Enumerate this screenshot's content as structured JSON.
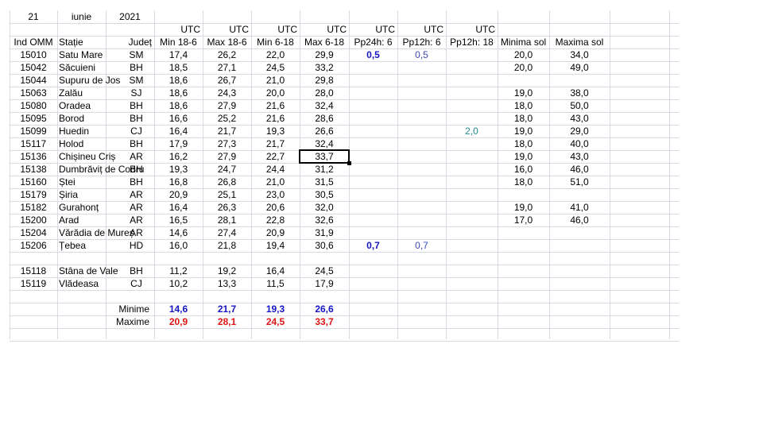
{
  "header": {
    "day": "21",
    "month": "iunie",
    "year": "2021"
  },
  "utc_label": "UTC",
  "columns": [
    "Ind OMM",
    "Stație",
    "Județ",
    "Min 18-6",
    "Max 18-6",
    "Min 6-18",
    "Max 6-18",
    "Pp24h: 6",
    "Pp12h: 6",
    "Pp12h: 18",
    "Minima sol",
    "Maxima sol"
  ],
  "rows": [
    {
      "omm": "15010",
      "station": "Satu Mare",
      "county": "SM",
      "min186": "17,4",
      "max186": "26,2",
      "min618": "22,0",
      "max618": "29,9",
      "pp24": "0,5",
      "pp12_6": "0,5",
      "pp12_18": "",
      "minsol": "20,0",
      "maxsol": "34,0"
    },
    {
      "omm": "15042",
      "station": "Săcuieni",
      "county": "BH",
      "min186": "18,5",
      "max186": "27,1",
      "min618": "24,5",
      "max618": "33,2",
      "pp24": "",
      "pp12_6": "",
      "pp12_18": "",
      "minsol": "20,0",
      "maxsol": "49,0"
    },
    {
      "omm": "15044",
      "station": "Supuru de Jos",
      "county": "SM",
      "min186": "18,6",
      "max186": "26,7",
      "min618": "21,0",
      "max618": "29,8",
      "pp24": "",
      "pp12_6": "",
      "pp12_18": "",
      "minsol": "",
      "maxsol": ""
    },
    {
      "omm": "15063",
      "station": "Zalău",
      "county": "SJ",
      "min186": "18,6",
      "max186": "24,3",
      "min618": "20,0",
      "max618": "28,0",
      "pp24": "",
      "pp12_6": "",
      "pp12_18": "",
      "minsol": "19,0",
      "maxsol": "38,0"
    },
    {
      "omm": "15080",
      "station": "Oradea",
      "county": "BH",
      "min186": "18,6",
      "max186": "27,9",
      "min618": "21,6",
      "max618": "32,4",
      "pp24": "",
      "pp12_6": "",
      "pp12_18": "",
      "minsol": "18,0",
      "maxsol": "50,0"
    },
    {
      "omm": "15095",
      "station": "Borod",
      "county": "BH",
      "min186": "16,6",
      "max186": "25,2",
      "min618": "21,6",
      "max618": "28,6",
      "pp24": "",
      "pp12_6": "",
      "pp12_18": "",
      "minsol": "18,0",
      "maxsol": "43,0"
    },
    {
      "omm": "15099",
      "station": "Huedin",
      "county": "CJ",
      "min186": "16,4",
      "max186": "21,7",
      "min618": "19,3",
      "max618": "26,6",
      "pp24": "",
      "pp12_6": "",
      "pp12_18": "2,0",
      "minsol": "19,0",
      "maxsol": "29,0"
    },
    {
      "omm": "15117",
      "station": "Holod",
      "county": "BH",
      "min186": "17,9",
      "max186": "27,3",
      "min618": "21,7",
      "max618": "32,4",
      "pp24": "",
      "pp12_6": "",
      "pp12_18": "",
      "minsol": "18,0",
      "maxsol": "40,0"
    },
    {
      "omm": "15136",
      "station": "Chișineu  Criș",
      "county": "AR",
      "min186": "16,2",
      "max186": "27,9",
      "min618": "22,7",
      "max618": "33,7",
      "pp24": "",
      "pp12_6": "",
      "pp12_18": "",
      "minsol": "19,0",
      "maxsol": "43,0"
    },
    {
      "omm": "15138",
      "station": "Dumbrăviț  de Codru",
      "county": "BH",
      "min186": "19,3",
      "max186": "24,7",
      "min618": "24,4",
      "max618": "31,2",
      "pp24": "",
      "pp12_6": "",
      "pp12_18": "",
      "minsol": "16,0",
      "maxsol": "46,0"
    },
    {
      "omm": "15160",
      "station": "Ștei",
      "county": "BH",
      "min186": "16,8",
      "max186": "26,8",
      "min618": "21,0",
      "max618": "31,5",
      "pp24": "",
      "pp12_6": "",
      "pp12_18": "",
      "minsol": "18,0",
      "maxsol": "51,0"
    },
    {
      "omm": "15179",
      "station": "Șiria",
      "county": "AR",
      "min186": "20,9",
      "max186": "25,1",
      "min618": "23,0",
      "max618": "30,5",
      "pp24": "",
      "pp12_6": "",
      "pp12_18": "",
      "minsol": "",
      "maxsol": ""
    },
    {
      "omm": "15182",
      "station": "Gurahonț",
      "county": "AR",
      "min186": "16,4",
      "max186": "26,3",
      "min618": "20,6",
      "max618": "32,0",
      "pp24": "",
      "pp12_6": "",
      "pp12_18": "",
      "minsol": "19,0",
      "maxsol": "41,0"
    },
    {
      "omm": "15200",
      "station": "Arad",
      "county": "AR",
      "min186": "16,5",
      "max186": "28,1",
      "min618": "22,8",
      "max618": "32,6",
      "pp24": "",
      "pp12_6": "",
      "pp12_18": "",
      "minsol": "17,0",
      "maxsol": "46,0"
    },
    {
      "omm": "15204",
      "station": "Vărădia de Mureș",
      "county": "AR",
      "min186": "14,6",
      "max186": "27,4",
      "min618": "20,9",
      "max618": "31,9",
      "pp24": "",
      "pp12_6": "",
      "pp12_18": "",
      "minsol": "",
      "maxsol": ""
    },
    {
      "omm": "15206",
      "station": "Țebea",
      "county": "HD",
      "min186": "16,0",
      "max186": "21,8",
      "min618": "19,4",
      "max618": "30,6",
      "pp24": "0,7",
      "pp12_6": "0,7",
      "pp12_18": "",
      "minsol": "",
      "maxsol": ""
    },
    {
      "omm": "15118",
      "station": "Stâna de Vale",
      "county": "BH",
      "min186": "11,2",
      "max186": "19,2",
      "min618": "16,4",
      "max618": "24,5",
      "pp24": "",
      "pp12_6": "",
      "pp12_18": "",
      "minsol": "",
      "maxsol": ""
    },
    {
      "omm": "15119",
      "station": "Vlădeasa",
      "county": "CJ",
      "min186": "10,2",
      "max186": "13,3",
      "min618": "11,5",
      "max618": "17,9",
      "pp24": "",
      "pp12_6": "",
      "pp12_18": "",
      "minsol": "",
      "maxsol": ""
    }
  ],
  "summary": {
    "min_label": "Minime",
    "max_label": "Maxime",
    "minime": [
      "14,6",
      "21,7",
      "19,3",
      "26,6"
    ],
    "maxime": [
      "20,9",
      "28,1",
      "24,5",
      "33,7"
    ]
  },
  "selected_cell": "33,7",
  "colors": {
    "grid": "#d9d9e3",
    "blue": "#1414c8",
    "red": "#e01414",
    "teal": "#1e8c8c"
  }
}
